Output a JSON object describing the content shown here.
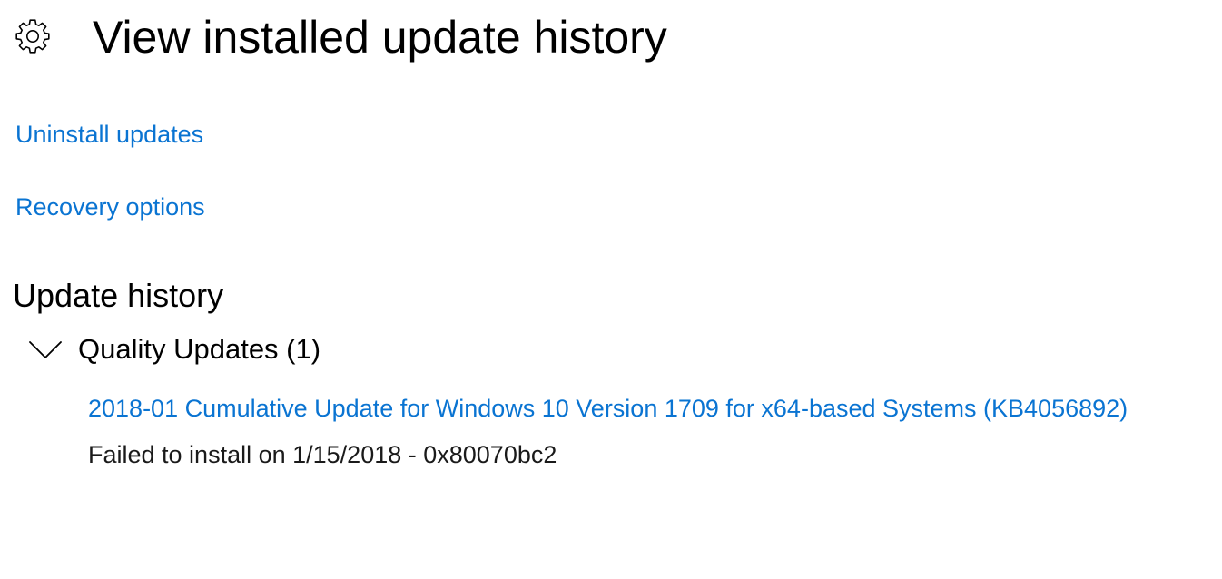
{
  "header": {
    "title": "View installed update history",
    "icon": "gear-icon"
  },
  "links": {
    "uninstall": "Uninstall updates",
    "recovery": "Recovery options"
  },
  "history": {
    "section_title": "Update history",
    "groups": [
      {
        "title": "Quality Updates (1)",
        "expanded": true,
        "icon": "chevron-down-icon",
        "items": [
          {
            "name": "2018-01 Cumulative Update for Windows 10 Version 1709 for x64-based Systems (KB4056892)",
            "status": "Failed to install on 1/15/2018 - 0x80070bc2"
          }
        ]
      }
    ]
  },
  "colors": {
    "link": "#0a74d2",
    "text": "#000000",
    "background": "#ffffff"
  }
}
